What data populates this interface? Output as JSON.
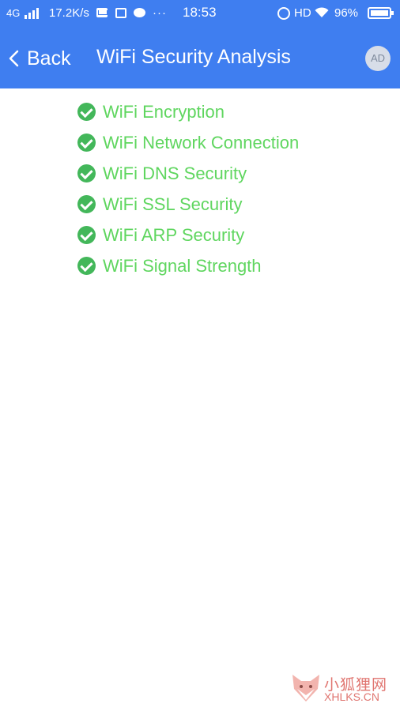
{
  "status_bar": {
    "network": "4G",
    "speed": "17.2K/s",
    "dots": "···",
    "time": "18:53",
    "hd": "HD",
    "battery": "96%"
  },
  "nav": {
    "back_label": "Back",
    "title": "WiFi Security Analysis",
    "ad_label": "AD"
  },
  "checks": [
    {
      "label": "WiFi Encryption",
      "status": "passed"
    },
    {
      "label": "WiFi Network Connection",
      "status": "passed"
    },
    {
      "label": "WiFi DNS Security",
      "status": "passed"
    },
    {
      "label": "WiFi SSL Security",
      "status": "passed"
    },
    {
      "label": "WiFi ARP Security",
      "status": "passed"
    },
    {
      "label": "WiFi Signal Strength",
      "status": "passed"
    }
  ],
  "watermark": {
    "text_cn": "小狐狸网",
    "text_en": "XHLKS.CN"
  },
  "colors": {
    "header": "#3f7ef0",
    "check_icon": "#43b75a",
    "check_text": "#5fd65f"
  },
  "icons": {
    "status": [
      "signal-icon",
      "mail-icon",
      "message-icon",
      "alarm-icon",
      "wifi-icon",
      "battery-icon"
    ],
    "nav": [
      "back-chevron-icon"
    ],
    "rows": "check-circle-icon"
  }
}
